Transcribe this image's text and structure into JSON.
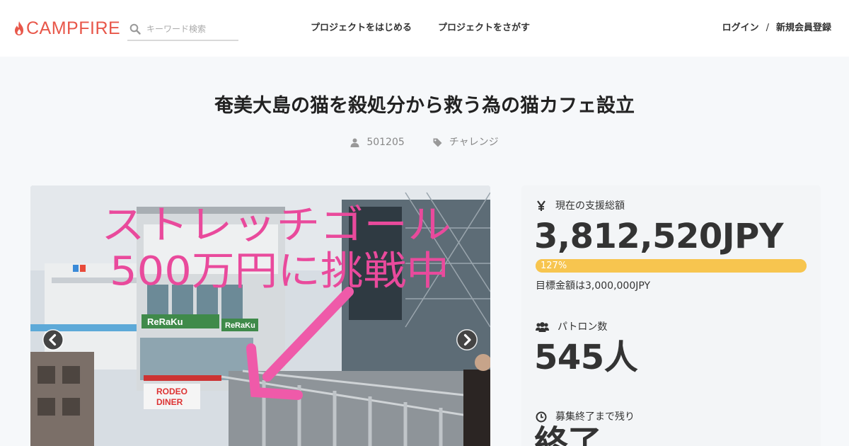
{
  "header": {
    "logo_text": "CAMPFIRE",
    "search_placeholder": "キーワード検索",
    "nav": {
      "start_project": "プロジェクトをはじめる",
      "find_project": "プロジェクトをさがす"
    },
    "login": "ログイン",
    "separator": "/",
    "signup": "新規会員登録"
  },
  "project": {
    "title": "奄美大島の猫を殺処分から救う為の猫カフェ設立",
    "owner": "501205",
    "category": "チャレンジ"
  },
  "photo": {
    "overlay_line1": "ストレッチゴール",
    "overlay_line2": "500万円に挑戦中",
    "signs": [
      "ReRaKu",
      "ReRaKu",
      "RODEO",
      "DINER"
    ]
  },
  "stats": {
    "raised_label": "現在の支援総額",
    "raised_value": "3,812,520JPY",
    "progress_text": "127%",
    "progress_fraction": 1.0,
    "goal_text": "目標金額は3,000,000JPY",
    "patrons_label": "パトロン数",
    "patrons_value": "545人",
    "remaining_label": "募集終了まで残り",
    "remaining_value": "終了"
  },
  "colors": {
    "brand": "#e8574a",
    "progress": "#f7c54f",
    "overlay_text": "#e94a9c"
  },
  "icons": {
    "search": "search-icon",
    "user": "user-icon",
    "tag": "tag-icon",
    "yen": "yen-icon",
    "users": "users-icon",
    "clock": "clock-icon",
    "prev": "chevron-left-icon",
    "next": "chevron-right-icon"
  }
}
